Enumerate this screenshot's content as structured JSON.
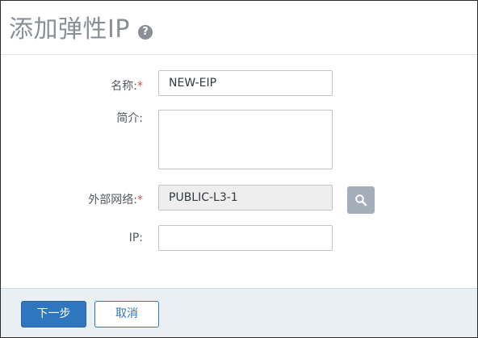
{
  "dialog": {
    "title": "添加弹性IP",
    "help_icon": "question-circle-icon"
  },
  "form": {
    "name": {
      "label": "名称:",
      "required_mark": "*",
      "value": "NEW-EIP"
    },
    "description": {
      "label": "简介:",
      "value": ""
    },
    "network": {
      "label": "外部网络:",
      "required_mark": "*",
      "value": "PUBLIC-L3-1",
      "search_icon": "search-icon"
    },
    "ip": {
      "label": "IP:",
      "value": ""
    }
  },
  "footer": {
    "next_label": "下一步",
    "cancel_label": "取消"
  },
  "colors": {
    "primary": "#2e76bd",
    "required": "#d9534f",
    "footer_bg": "#eaeff4"
  }
}
